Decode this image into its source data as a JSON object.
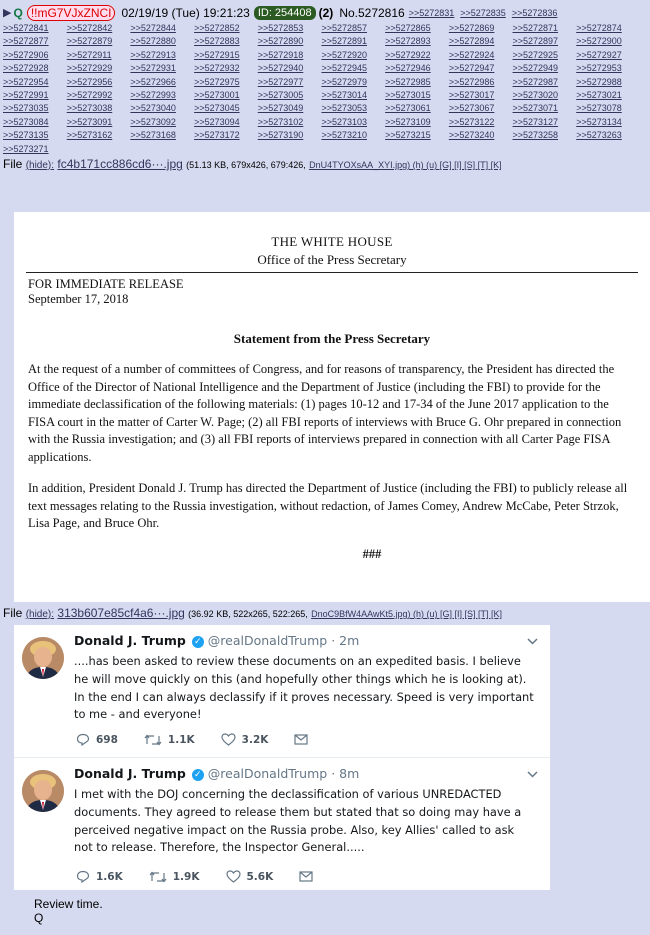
{
  "post": {
    "name": "Q",
    "tripcode": "!!mG7VJxZNCI",
    "datetime": "02/19/19 (Tue) 19:21:23",
    "id_label": "ID: 254408",
    "id_count": "(2)",
    "post_no": "No.5272816",
    "header_backlinks": [
      ">>5272831",
      ">>5272835",
      ">>5272836"
    ],
    "backlinks": [
      ">>5272841",
      ">>5272842",
      ">>5272844",
      ">>5272852",
      ">>5272853",
      ">>5272857",
      ">>5272865",
      ">>5272869",
      ">>5272871",
      ">>5272874",
      ">>5272877",
      ">>5272879",
      ">>5272880",
      ">>5272883",
      ">>5272890",
      ">>5272891",
      ">>5272893",
      ">>5272894",
      ">>5272897",
      ">>5272900",
      ">>5272906",
      ">>5272911",
      ">>5272913",
      ">>5272915",
      ">>5272918",
      ">>5272920",
      ">>5272922",
      ">>5272924",
      ">>5272925",
      ">>5272927",
      ">>5272928",
      ">>5272929",
      ">>5272931",
      ">>5272932",
      ">>5272940",
      ">>5272945",
      ">>5272946",
      ">>5272947",
      ">>5272949",
      ">>5272953",
      ">>5272954",
      ">>5272956",
      ">>5272966",
      ">>5272975",
      ">>5272977",
      ">>5272979",
      ">>5272985",
      ">>5272986",
      ">>5272987",
      ">>5272988",
      ">>5272991",
      ">>5272992",
      ">>5272993",
      ">>5273001",
      ">>5273005",
      ">>5273014",
      ">>5273015",
      ">>5273017",
      ">>5273020",
      ">>5273021",
      ">>5273035",
      ">>5273038",
      ">>5273040",
      ">>5273045",
      ">>5273049",
      ">>5273053",
      ">>5273061",
      ">>5273067",
      ">>5273071",
      ">>5273078",
      ">>5273084",
      ">>5273091",
      ">>5273092",
      ">>5273094",
      ">>5273102",
      ">>5273103",
      ">>5273109",
      ">>5273122",
      ">>5273127",
      ">>5273134",
      ">>5273135",
      ">>5273162",
      ">>5273168",
      ">>5273172",
      ">>5273190",
      ">>5273210",
      ">>5273215",
      ">>5273240",
      ">>5273258",
      ">>5273263",
      ">>5273271"
    ],
    "message_lines": [
      "Review time.",
      "Q"
    ]
  },
  "files": [
    {
      "label": "File",
      "hide": "(hide):",
      "name": "fc4b171cc886cd6···.jpg",
      "meta": "(51.13 KB, 679x426, 679:426,",
      "orig": "DnU4TYOXsAA_XYI.jpg",
      "actions": ") (h) (u) [G] [I] [S] [T] [K]"
    },
    {
      "label": "File",
      "hide": "(hide):",
      "name": "313b607e85cf4a6···.jpg",
      "meta": "(36.92 KB, 522x265, 522:265,",
      "orig": "DnoC9BfW4AAwKt5.jpg",
      "actions": ") (h) (u) [G] [I] [S] [T] [K]"
    }
  ],
  "press_release": {
    "org": "THE WHITE HOUSE",
    "office": "Office of the Press Secretary",
    "release": "FOR IMMEDIATE RELEASE",
    "date": "September 17, 2018",
    "statement_title": "Statement from the Press Secretary",
    "para1": "At the request of a number of committees of Congress, and for reasons of transparency, the President has directed the Office of the Director of National Intelligence and the Department of Justice (including the FBI) to provide for the immediate declassification of the following materials: (1) pages 10-12 and 17-34 of the June 2017 application to the FISA court in the matter of Carter W. Page; (2) all FBI reports of interviews with Bruce G. Ohr prepared in connection with the Russia investigation; and (3) all FBI reports of interviews prepared in connection with all Carter Page FISA applications.",
    "para2": "In addition, President Donald J. Trump has directed the Department of Justice (including the FBI) to publicly release all text messages relating to the Russia investigation, without redaction, of James Comey, Andrew McCabe, Peter Strzok, Lisa Page, and Bruce Ohr.",
    "end_mark": "###",
    "dashes": "-----"
  },
  "tweets": [
    {
      "name": "Donald J. Trump",
      "handle": "@realDonaldTrump · 2m",
      "text": "....has been asked to review these documents on an expedited basis. I believe he will move quickly on this (and hopefully other things which he is looking at). In the end I can always declassify if it proves necessary. Speed is very important to me - and everyone!",
      "replies": "698",
      "retweets": "1.1K",
      "likes": "3.2K"
    },
    {
      "name": "Donald J. Trump",
      "handle": "@realDonaldTrump · 8m",
      "text": "I met with the DOJ concerning the declassification of various UNREDACTED documents. They agreed to release them but stated that so doing may have a perceived negative impact on the Russia probe. Also, key Allies' called to ask not to release. Therefore, the Inspector General.....",
      "replies": "1.6K",
      "retweets": "1.9K",
      "likes": "5.6K"
    }
  ],
  "colors": {
    "post_bg": "#d6daf0",
    "link": "#34345c",
    "name_green": "#117743",
    "tripcode_red": "#dd0000",
    "id_bg": "#2b5b22",
    "verified_blue": "#1da1f2"
  }
}
